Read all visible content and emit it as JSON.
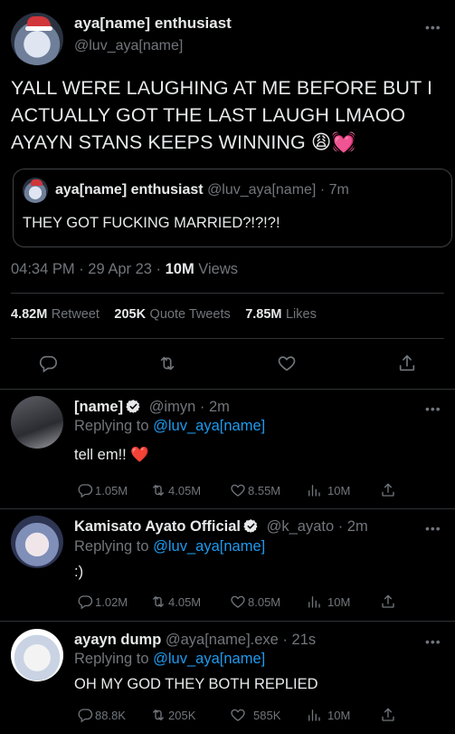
{
  "main_tweet": {
    "display_name": "aya[name] enthusiast",
    "handle": "@luv_aya[name]",
    "text": "YALL WERE LAUGHING AT ME BEFORE BUT I ACTUALLY GOT THE LAST LAUGH LMAOO AYAYN STANS KEEPS WINNING",
    "emoji": "😩💓",
    "time": "04:34 PM · 29 Apr 23 · ",
    "views_count": "10M",
    "views_label": " Views",
    "retweets_count": "4.82M",
    "retweets_label": "Retweet",
    "quotes_count": "205K",
    "quotes_label": "Quote Tweets",
    "likes_count": "7.85M",
    "likes_label": "Likes"
  },
  "quoted_tweet": {
    "display_name": "aya[name] enthusiast",
    "handle": "@luv_aya[name]",
    "time": " · 7m",
    "text": "THEY GOT FUCKING MARRIED?!?!?!"
  },
  "replies": [
    {
      "display_name": "[name]",
      "handle": "@imyn",
      "time": " · 2m",
      "replying_prefix": "Replying to ",
      "replying_to": "@luv_aya[name]",
      "text": "tell em!! ❤️",
      "reply_count": "1.05M",
      "retweet_count": "4.05M",
      "like_count": "8.55M",
      "view_count": "10M"
    },
    {
      "display_name": "Kamisato Ayato Official",
      "handle": "@k_ayato",
      "time": " · 2m",
      "replying_prefix": "Replying to ",
      "replying_to": "@luv_aya[name]",
      "text": ":)",
      "reply_count": "1.02M",
      "retweet_count": "4.05M",
      "like_count": "8.05M",
      "view_count": "10M"
    },
    {
      "display_name": "ayayn dump",
      "handle": "@aya[name].exe",
      "time": " · 21s",
      "replying_prefix": "Replying to ",
      "replying_to": "@luv_aya[name]",
      "text": "OH MY GOD THEY BOTH REPLIED",
      "reply_count": "88.8K",
      "retweet_count": "205K",
      "like_count": "585K",
      "view_count": "10M"
    }
  ],
  "more_label": "•••",
  "colors": {
    "background": "#000000",
    "text": "#e7e9ea",
    "muted": "#71767b",
    "accent": "#1d9bf0",
    "divider": "#2f3336"
  }
}
